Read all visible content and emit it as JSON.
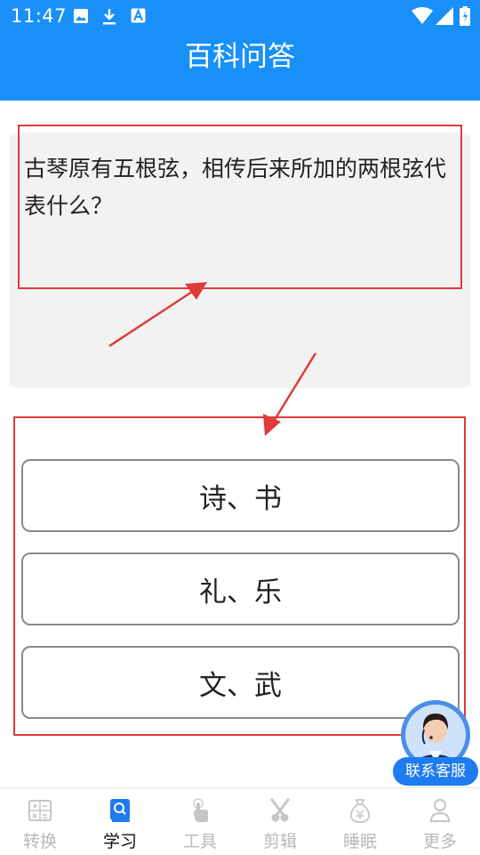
{
  "status_bar": {
    "time": "11:47"
  },
  "header": {
    "title": "百科问答"
  },
  "question": {
    "text": "古琴原有五根弦，相传后来所加的两根弦代表什么？"
  },
  "options": [
    {
      "label": "诗、书"
    },
    {
      "label": "礼、乐"
    },
    {
      "label": "文、武"
    }
  ],
  "service": {
    "label": "联系客服"
  },
  "tabs": [
    {
      "label": "转换",
      "icon": "calculator-icon",
      "active": false
    },
    {
      "label": "学习",
      "icon": "book-search-icon",
      "active": true
    },
    {
      "label": "工具",
      "icon": "tap-hand-icon",
      "active": false
    },
    {
      "label": "剪辑",
      "icon": "scissors-icon",
      "active": false
    },
    {
      "label": "睡眠",
      "icon": "moneybag-icon",
      "active": false
    },
    {
      "label": "更多",
      "icon": "person-icon",
      "active": false
    }
  ],
  "colors": {
    "header": "#1890f8",
    "highlight": "#e03a3a",
    "tab_active": "#111111",
    "tab_inactive": "#b9b9b9",
    "active_icon": "#1f7bf0"
  }
}
